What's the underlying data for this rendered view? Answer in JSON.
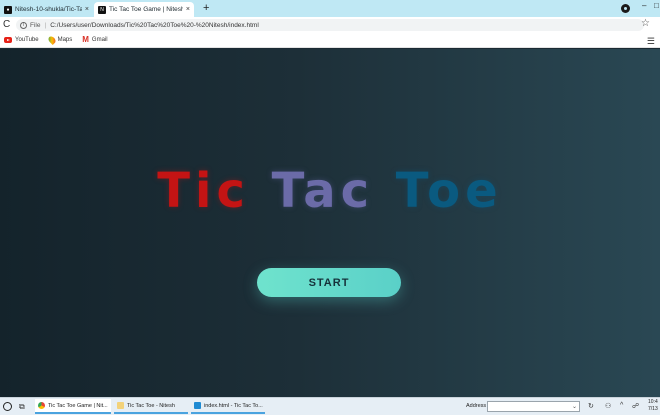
{
  "browser": {
    "tabs": [
      {
        "label": "Nitesh-10-shukla/Tic-Ta",
        "active": false
      },
      {
        "label": "Tic Tac Toe Game | Nitesh Shukla",
        "active": true
      }
    ],
    "new_tab": "+",
    "reload": "C",
    "file_chip": "File",
    "url": "C:/Users/user/Downloads/Tic%20Tac%20Toe%20-%20Nitesh/index.html",
    "star": "☆",
    "bookmarks": [
      {
        "label": "YouTube",
        "icon": "youtube-icon"
      },
      {
        "label": "Maps",
        "icon": "maps-icon"
      },
      {
        "label": "Gmail",
        "icon": "gmail-icon"
      }
    ],
    "window_controls": {
      "minimize": "–",
      "maximize": "□"
    }
  },
  "page": {
    "title_words": [
      "Tic",
      "Tac",
      "Toe"
    ],
    "title_colors": [
      "#c41414",
      "#6b6ba8",
      "#0a5a80"
    ],
    "start_label": "START",
    "accent": "#5ad0c8"
  },
  "taskbar": {
    "items": [
      {
        "label": "Tic Tac Toe Game | Nit...",
        "icon": "chrome-icon"
      },
      {
        "label": "Tic Tac Toe - Nitesh",
        "icon": "notepad-icon"
      },
      {
        "label": "index.html - Tic Tac To...",
        "icon": "vscode-icon"
      }
    ],
    "address_label": "Address",
    "address_value": "",
    "clock_time": "10:4",
    "clock_date": "7/13"
  }
}
